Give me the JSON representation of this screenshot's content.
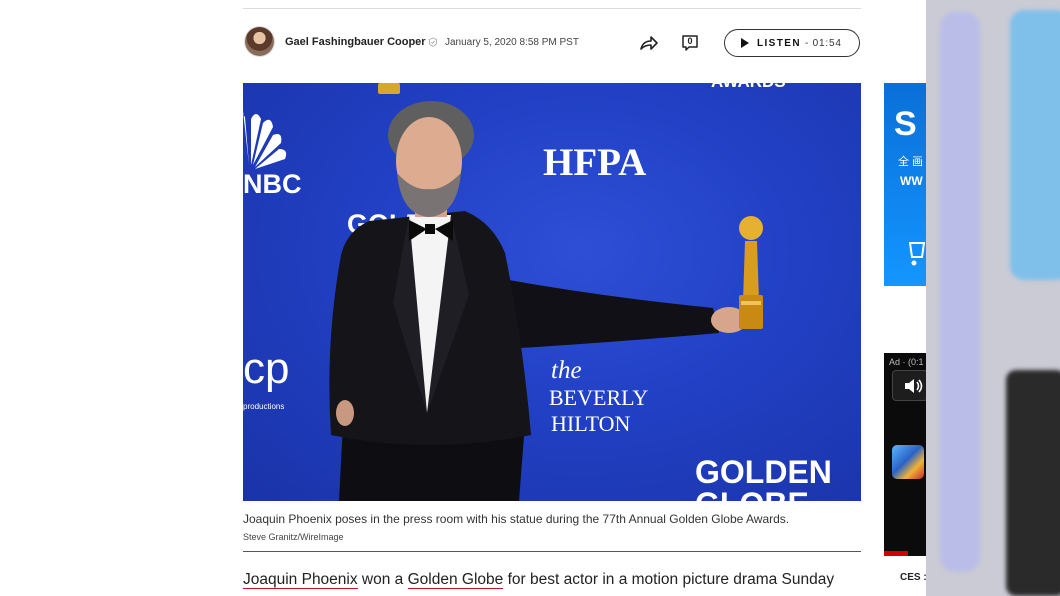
{
  "article_meta": {
    "author": "Gael Fashingbauer Cooper",
    "date": "January 5, 2020 8:58 PM PST",
    "comment_count": "0",
    "listen_label": "LISTEN",
    "listen_duration": "- 01:54"
  },
  "photo": {
    "backdrop_text": {
      "hfpa": "HFPA",
      "nbc": "NBC",
      "golden": "GOLDEN",
      "golden_partial": "GOLD",
      "globe_partial": "GLOBE",
      "awards_partial": "AWARDS",
      "the": "the",
      "beverly": "BEVERLY",
      "hilton": "HILTON",
      "cp": "cp",
      "productions": "productions"
    },
    "caption": "Joaquin Phoenix poses in the press room with his statue during the 77th Annual Golden Globe Awards.",
    "credit": "Steve Granitz/WireImage"
  },
  "article": {
    "link_person": "Joaquin Phoenix",
    "text_1": " won a ",
    "link_award": "Golden Globe",
    "text_2": " for best actor in a motion picture drama Sunday"
  },
  "sidebar": {
    "ad1_big_text": "S",
    "ad1_small_text": "全 画",
    "ad1_www": "WW",
    "ad2_label": "Ad · (0:1",
    "ces_text": "CES :"
  },
  "colors": {
    "photo_backdrop": "#2140c4",
    "link_underline": "#c8102e",
    "ad_blue": "#1496ff"
  },
  "icons": [
    "verified-icon",
    "share-icon",
    "comment-icon",
    "play-icon",
    "sound-icon"
  ]
}
